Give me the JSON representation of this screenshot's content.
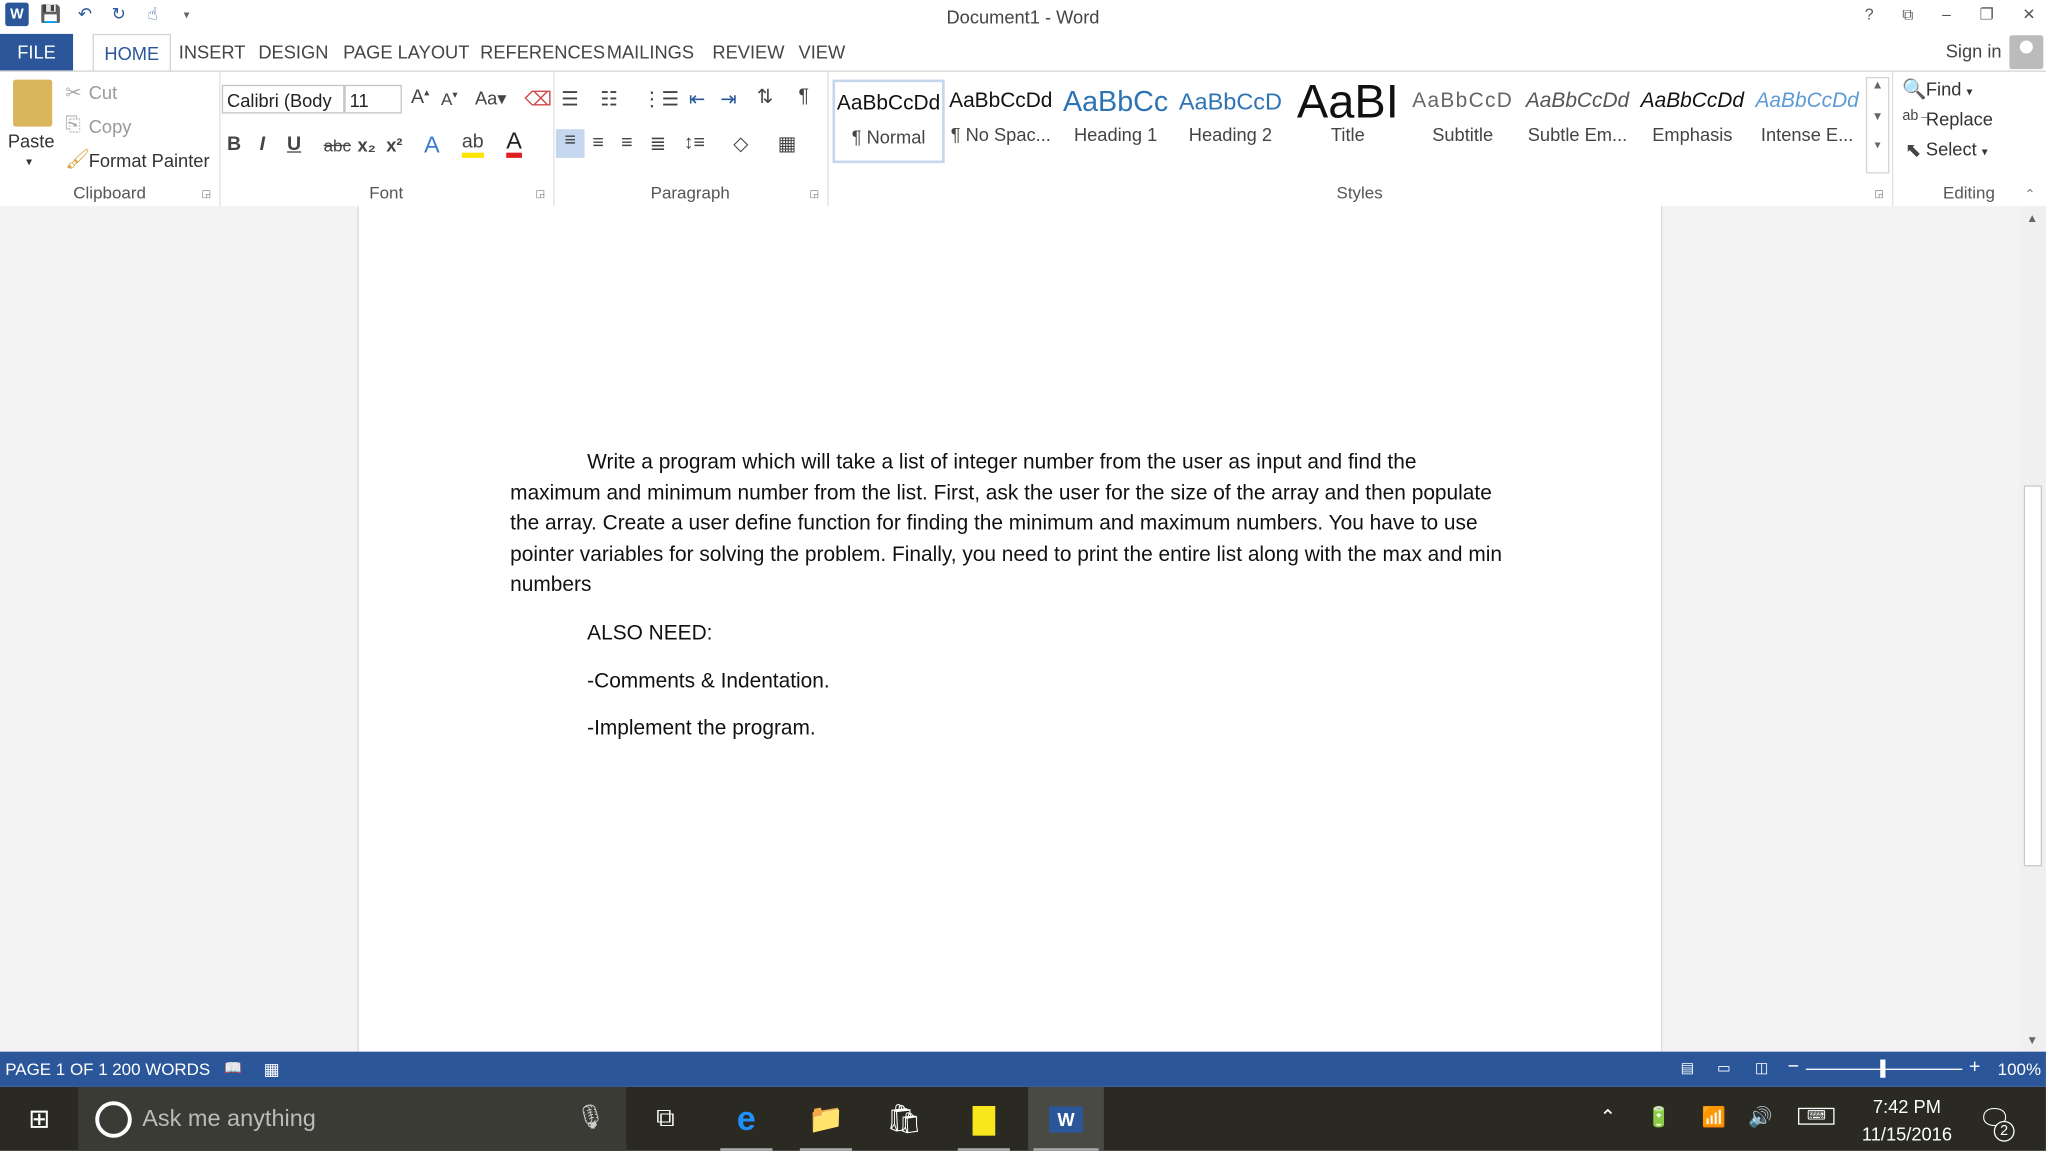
{
  "window": {
    "title": "Document1 - Word",
    "help": "?",
    "controls": [
      "–",
      "❐",
      "✕"
    ]
  },
  "tabs": {
    "file": "FILE",
    "items": [
      "HOME",
      "INSERT",
      "DESIGN",
      "PAGE LAYOUT",
      "REFERENCES",
      "MAILINGS",
      "REVIEW",
      "VIEW"
    ],
    "active": "HOME",
    "sign_in": "Sign in"
  },
  "clipboard": {
    "paste": "Paste",
    "cut": "Cut",
    "copy": "Copy",
    "format_painter": "Format Painter",
    "label": "Clipboard"
  },
  "font": {
    "name": "Calibri (Body",
    "size": "11",
    "label": "Font",
    "change_case": "Aa",
    "bold": "B",
    "italic": "I",
    "underline": "U",
    "strike": "abc",
    "sub": "x₂",
    "sup": "x²"
  },
  "paragraph": {
    "label": "Paragraph"
  },
  "styles": {
    "label": "Styles",
    "items": [
      {
        "preview": "AaBbCcDd",
        "name": "¶ Normal"
      },
      {
        "preview": "AaBbCcDd",
        "name": "¶ No Spac..."
      },
      {
        "preview": "AaBbCc",
        "name": "Heading 1"
      },
      {
        "preview": "AaBbCcD",
        "name": "Heading 2"
      },
      {
        "preview": "AaBI",
        "name": "Title"
      },
      {
        "preview": "AaBbCcD",
        "name": "Subtitle"
      },
      {
        "preview": "AaBbCcDd",
        "name": "Subtle Em..."
      },
      {
        "preview": "AaBbCcDd",
        "name": "Emphasis"
      },
      {
        "preview": "AaBbCcDd",
        "name": "Intense E..."
      }
    ]
  },
  "editing": {
    "find": "Find",
    "replace": "Replace",
    "select": "Select",
    "label": "Editing"
  },
  "document": {
    "paragraph1": "Write a program which will take a list of integer number from the user as input and find the maximum and minimum number from the list. First, ask the user for the size of the array and then populate the array. Create a user define function for finding the minimum and maximum numbers. You have to use pointer variables for solving the problem. Finally, you need to print the entire list along with the max and min numbers",
    "line2": "ALSO NEED:",
    "line3": "-Comments & Indentation.",
    "line4": "-Implement the program."
  },
  "status": {
    "page": "PAGE 1 OF 1",
    "words": "200 WORDS",
    "zoom": "100%",
    "zoom_level": 1.0
  },
  "taskbar": {
    "search_placeholder": "Ask me anything",
    "time": "7:42 PM",
    "date": "11/15/2016",
    "notifications": "2"
  },
  "colors": {
    "accent": "#2b579a",
    "taskbar": "#2a2a22"
  }
}
